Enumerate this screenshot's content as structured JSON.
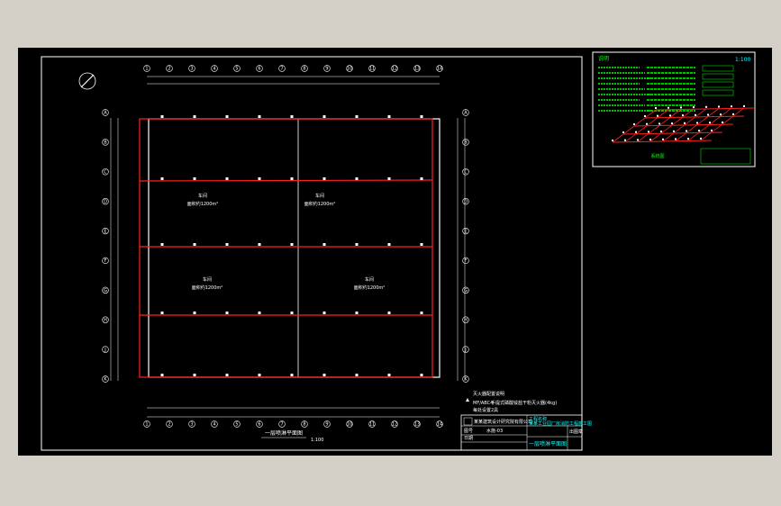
{
  "drawing": {
    "scale_label": "1:100",
    "plan_title": "一层喷淋平面图",
    "plan_scale_suffix": "1:100",
    "axonometric_caption": "系统图",
    "legend_heading": "灭火器配置说明",
    "legend_item_1": "MF/ABC4",
    "legend_item_1_desc": "手提式磷酸铵盐干粉灭火器(4kg)",
    "legend_item_2": "每处设置2具",
    "notes_heading": "说明",
    "title_block": {
      "company": "某某建筑设计研究院有限公司",
      "project_label": "工程名称",
      "project_name": "某某工业园厂房消防工程施工图",
      "drawing_name": "一层喷淋平面图",
      "sheet_label": "图号",
      "sheet_no": "水施-03",
      "date_label": "日期",
      "stamp": "出图章"
    },
    "room_labels": [
      {
        "name": "车间",
        "sub": "面积约1200m²"
      },
      {
        "name": "车间",
        "sub": "面积约1200m²"
      },
      {
        "name": "车间",
        "sub": "面积约1200m²"
      },
      {
        "name": "车间",
        "sub": "面积约1200m²"
      }
    ],
    "column_tags_top": [
      "1",
      "2",
      "3",
      "4",
      "5",
      "6",
      "7",
      "8",
      "9",
      "10",
      "11",
      "12",
      "13",
      "14"
    ],
    "row_tags_left": [
      "A",
      "B",
      "C",
      "D",
      "E",
      "F",
      "G",
      "H",
      "J",
      "K"
    ],
    "colors": {
      "background": "#000000",
      "frame": "#ffffff",
      "sprinkler_main": "#ff2020",
      "notes_text": "#00ff00",
      "title_text": "#00ffff"
    }
  }
}
